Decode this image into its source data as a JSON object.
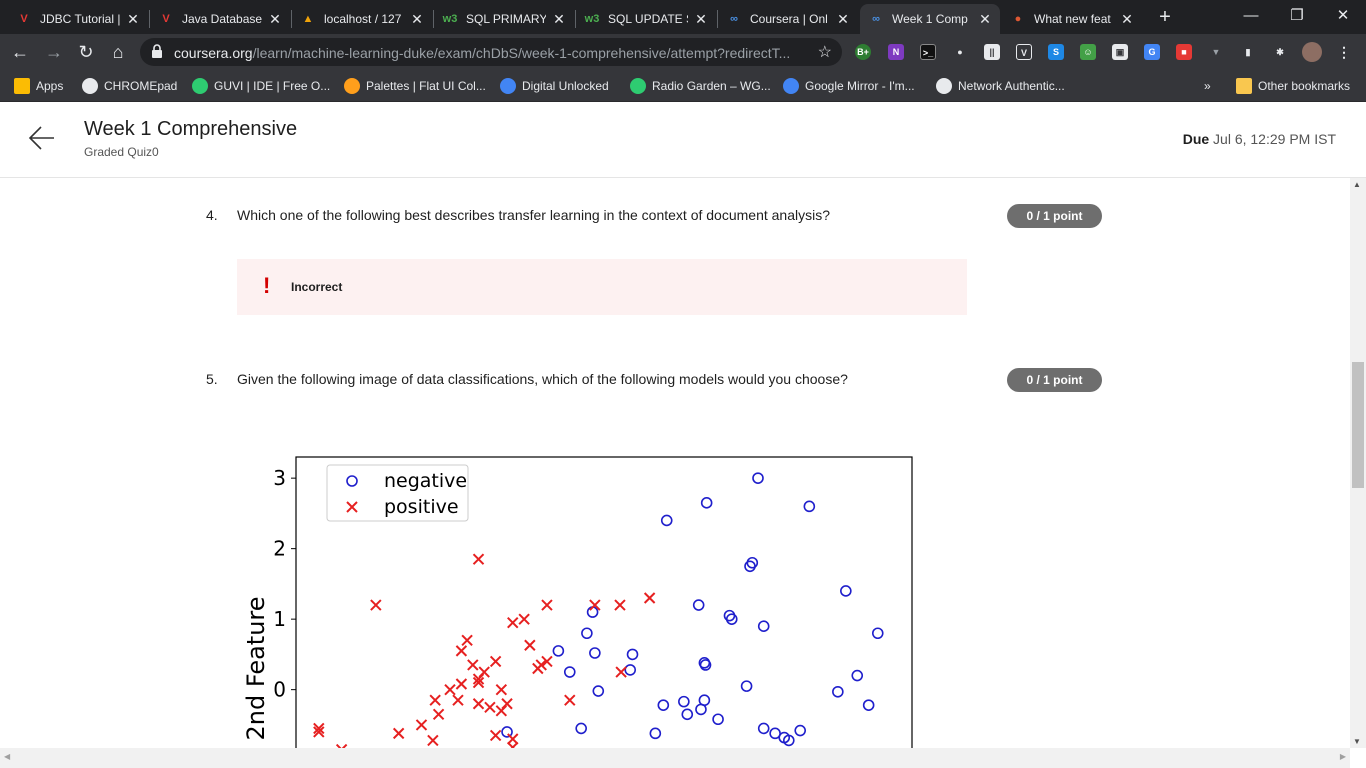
{
  "browser": {
    "tabs": [
      {
        "label": "JDBC Tutorial |",
        "icon": "vivid-v-icon",
        "color": "#e53935"
      },
      {
        "label": "Java Database",
        "icon": "vivid-v-icon",
        "color": "#e53935"
      },
      {
        "label": "localhost / 127",
        "icon": "phpmyadmin-icon",
        "color": "#f0a30a"
      },
      {
        "label": "SQL PRIMARY",
        "icon": "w3schools-icon",
        "color": "#4caf50"
      },
      {
        "label": "SQL UPDATE S",
        "icon": "w3schools-icon",
        "color": "#4caf50"
      },
      {
        "label": "Coursera | Onl",
        "icon": "coursera-icon",
        "color": "#4a90e2"
      },
      {
        "label": "Week 1 Comp",
        "icon": "coursera-icon",
        "color": "#4a90e2"
      },
      {
        "label": "What new feat",
        "icon": "duckduckgo-icon",
        "color": "#de5833"
      }
    ],
    "url_host": "coursera.org",
    "url_path": "/learn/machine-learning-duke/exam/chDbS/week-1-comprehensive/attempt?redirectT...",
    "bookmarks": [
      {
        "label": "Apps",
        "icon": "apps-grid-icon"
      },
      {
        "label": "CHROMEpad",
        "icon": "globe-icon"
      },
      {
        "label": "GUVI | IDE | Free O...",
        "icon": "guvi-icon"
      },
      {
        "label": "Palettes | Flat UI Col...",
        "icon": "palette-icon"
      },
      {
        "label": "Digital Unlocked",
        "icon": "google-icon"
      },
      {
        "label": "Radio Garden – WG...",
        "icon": "radio-garden-icon"
      },
      {
        "label": "Google Mirror - I'm...",
        "icon": "mirror-icon"
      },
      {
        "label": "Network Authentic...",
        "icon": "globe-icon"
      }
    ],
    "overflow_label": "»",
    "other_bookmarks": "Other bookmarks"
  },
  "header": {
    "title": "Week 1 Comprehensive",
    "subtitle": "Graded Quiz0",
    "due_label": "Due",
    "due_value": "Jul 6, 12:29 PM IST"
  },
  "questions": [
    {
      "number": "4.",
      "text": "Which one of the following best describes transfer learning in the context of document analysis?",
      "points": "0 / 1 point",
      "feedback": "Incorrect"
    },
    {
      "number": "5.",
      "text": "Given the following image of data classifications, which of the following models would you choose?",
      "points": "0 / 1 point"
    }
  ],
  "chart_data": {
    "type": "scatter",
    "ylabel": "2nd Feature",
    "yticks": [
      "3",
      "2",
      "1",
      "0"
    ],
    "ylim_visible": [
      -0.85,
      3.2
    ],
    "xlim": [
      -3.2,
      2.2
    ],
    "legend": {
      "placement": "top-left",
      "entries": [
        "negative",
        "positive"
      ]
    },
    "colors": {
      "negative": "#1f1fcc",
      "positive": "#e62020"
    },
    "series": [
      {
        "name": "negative",
        "marker": "circle",
        "points": [
          [
            0.85,
            3.0
          ],
          [
            0.4,
            2.65
          ],
          [
            0.05,
            2.4
          ],
          [
            1.3,
            2.6
          ],
          [
            0.8,
            1.8
          ],
          [
            0.78,
            1.75
          ],
          [
            1.62,
            1.4
          ],
          [
            0.33,
            1.2
          ],
          [
            0.6,
            1.05
          ],
          [
            0.62,
            1.0
          ],
          [
            0.9,
            0.9
          ],
          [
            1.9,
            0.8
          ],
          [
            -0.6,
            1.1
          ],
          [
            -0.65,
            0.8
          ],
          [
            -0.9,
            0.55
          ],
          [
            -0.58,
            0.52
          ],
          [
            -0.25,
            0.5
          ],
          [
            0.38,
            0.38
          ],
          [
            0.39,
            0.35
          ],
          [
            -0.27,
            0.28
          ],
          [
            -0.8,
            0.25
          ],
          [
            1.72,
            0.2
          ],
          [
            0.75,
            0.05
          ],
          [
            -0.55,
            -0.02
          ],
          [
            1.55,
            -0.03
          ],
          [
            0.38,
            -0.15
          ],
          [
            0.2,
            -0.17
          ],
          [
            0.02,
            -0.22
          ],
          [
            0.35,
            -0.28
          ],
          [
            1.82,
            -0.22
          ],
          [
            0.23,
            -0.35
          ],
          [
            0.5,
            -0.42
          ],
          [
            -1.35,
            -0.6
          ],
          [
            -0.7,
            -0.55
          ],
          [
            -0.05,
            -0.62
          ],
          [
            0.9,
            -0.55
          ],
          [
            1.0,
            -0.62
          ],
          [
            1.22,
            -0.58
          ],
          [
            1.08,
            -0.68
          ],
          [
            1.12,
            -0.72
          ]
        ]
      },
      {
        "name": "positive",
        "marker": "x",
        "points": [
          [
            -1.6,
            1.85
          ],
          [
            -2.5,
            1.2
          ],
          [
            -1.0,
            1.2
          ],
          [
            -1.2,
            1.0
          ],
          [
            -0.58,
            1.2
          ],
          [
            -0.36,
            1.2
          ],
          [
            -0.1,
            1.3
          ],
          [
            -1.3,
            0.95
          ],
          [
            -1.7,
            0.7
          ],
          [
            -1.15,
            0.63
          ],
          [
            -1.75,
            0.55
          ],
          [
            -1.65,
            0.35
          ],
          [
            -1.45,
            0.4
          ],
          [
            -1.0,
            0.4
          ],
          [
            -1.08,
            0.3
          ],
          [
            -1.05,
            0.35
          ],
          [
            -0.35,
            0.25
          ],
          [
            -1.55,
            0.25
          ],
          [
            -1.6,
            0.15
          ],
          [
            -1.75,
            0.08
          ],
          [
            -1.85,
            0.0
          ],
          [
            -1.6,
            0.1
          ],
          [
            -1.4,
            0.0
          ],
          [
            -1.6,
            -0.2
          ],
          [
            -1.78,
            -0.15
          ],
          [
            -1.5,
            -0.25
          ],
          [
            -1.35,
            -0.2
          ],
          [
            -1.4,
            -0.3
          ],
          [
            -1.98,
            -0.15
          ],
          [
            -0.8,
            -0.15
          ],
          [
            -1.95,
            -0.35
          ],
          [
            -2.1,
            -0.5
          ],
          [
            -3.0,
            -0.55
          ],
          [
            -3.0,
            -0.6
          ],
          [
            -2.3,
            -0.62
          ],
          [
            -2.0,
            -0.72
          ],
          [
            -1.3,
            -0.7
          ],
          [
            -1.45,
            -0.65
          ],
          [
            -2.8,
            -0.85
          ],
          [
            -1.3,
            -0.82
          ]
        ]
      }
    ]
  }
}
